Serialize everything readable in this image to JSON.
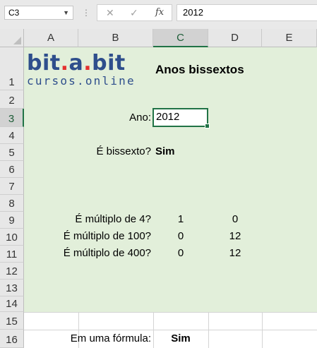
{
  "formula_bar": {
    "name_box": "C3",
    "cancel_glyph": "✕",
    "enter_glyph": "✓",
    "fx_glyph": "fx",
    "formula": "2012"
  },
  "columns": [
    "A",
    "B",
    "C",
    "D",
    "E"
  ],
  "selected_column": "C",
  "rows": [
    "1",
    "2",
    "3",
    "4",
    "5",
    "6",
    "7",
    "8",
    "9",
    "10",
    "11",
    "12",
    "13",
    "14",
    "15",
    "16"
  ],
  "selected_row": "3",
  "logo": {
    "line1_a": "bit",
    "dot1": ".",
    "line1_b": "a",
    "dot2": ".",
    "line1_c": "bit",
    "line2": "cursos.online"
  },
  "sheet": {
    "title": "Anos bissextos",
    "ano_label": "Ano:",
    "ano_value": "2012",
    "bissexto_label": "É bissexto?",
    "bissexto_value": "Sim",
    "mult4_label": "É múltiplo de 4?",
    "mult4_c": "1",
    "mult4_d": "0",
    "mult100_label": "É múltiplo de 100?",
    "mult100_c": "0",
    "mult100_d": "12",
    "mult400_label": "É múltiplo de 400?",
    "mult400_c": "0",
    "mult400_d": "12",
    "formula_label": "Em uma fórmula:",
    "formula_value": "Sim"
  },
  "colors": {
    "fill_green": "#e2efda",
    "selection_green": "#217346",
    "logo_blue": "#2e4e8c",
    "logo_red": "#e5312f"
  }
}
